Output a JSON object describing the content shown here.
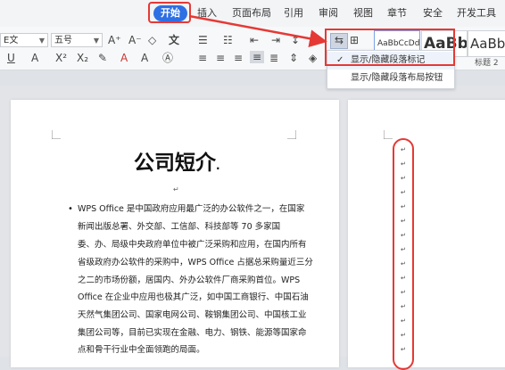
{
  "menu": {
    "start": "开始",
    "items": [
      "插入",
      "页面布局",
      "引用",
      "审阅",
      "视图",
      "章节",
      "安全",
      "开发工具"
    ]
  },
  "ribbon": {
    "font_name": "E文",
    "font_size": "五号",
    "styles": {
      "normal": "AaBbCcDd",
      "heading1": "AaBb",
      "heading2": "AaBb",
      "heading2_label": "标题 2"
    }
  },
  "dropdown": {
    "item1": "显示/隐藏段落标记",
    "item2": "显示/隐藏段落布局按钮"
  },
  "document": {
    "title": "公司短介",
    "title_suffix": ".",
    "lines": [
      "WPS Office 是中国政府应用最广泛的办公软件之一，在国家",
      "新闻出版总署、外交部、工信部、科技部等 70 多家国",
      "委、办、局级中央政府单位中被广泛采购和应用，在国内所有",
      "省级政府办公软件的采购中，WPS Office 占据总采购量近三分",
      "之二的市场份额，居国内、外办公软件厂商采购首位。WPS",
      "Office 在企业中应用也极其广泛，如中国工商银行、中国石油",
      "天然气集团公司、国家电网公司、鞍钢集团公司、中国核工业",
      "集团公司等，目前已实现在金融、电力、钢铁、能源等国家命",
      "点和骨干行业中全面领跑的局面。"
    ]
  },
  "colors": {
    "accent": "#2f6fe4",
    "annotation": "#e53935"
  }
}
